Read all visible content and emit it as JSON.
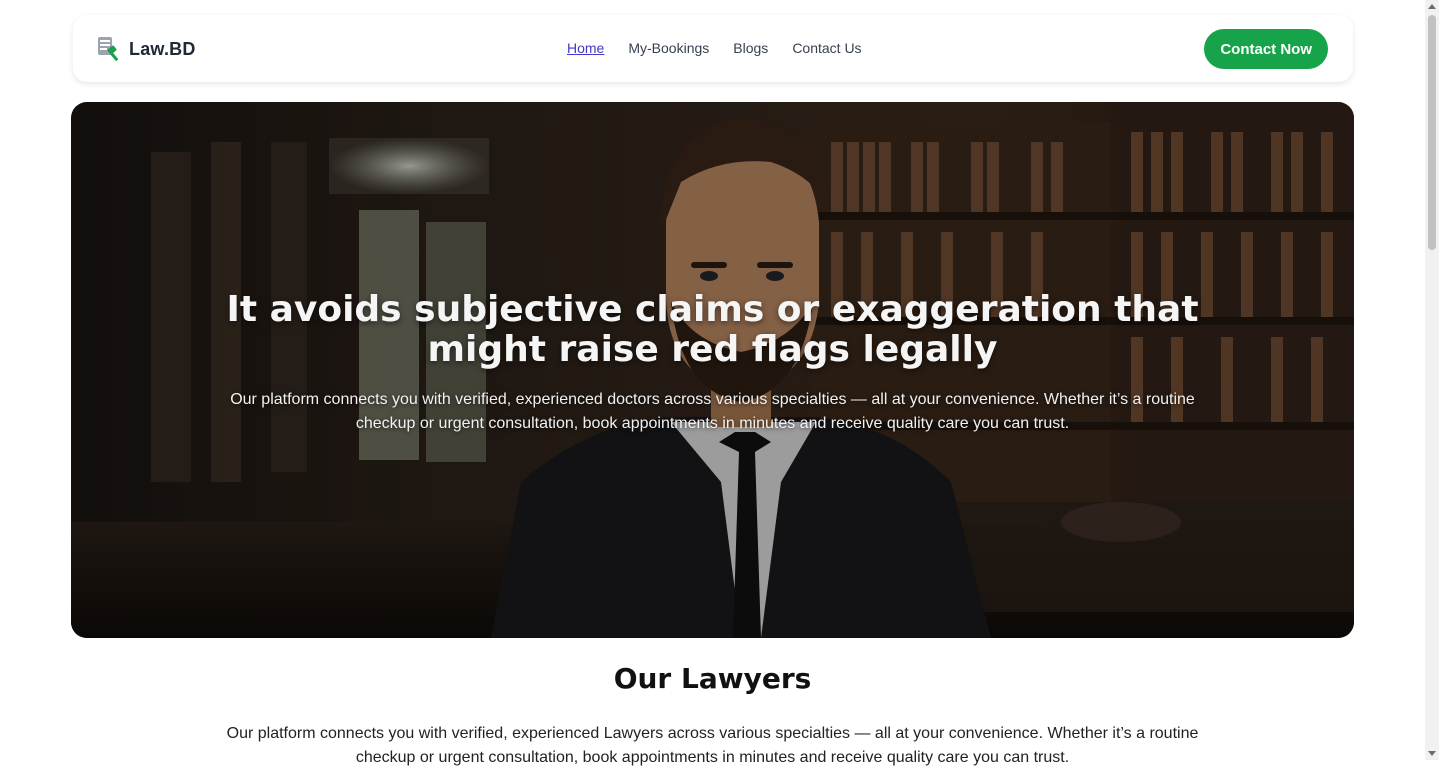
{
  "nav": {
    "brand": "Law.BD",
    "brand_icon": "gavel-document-icon",
    "links": [
      {
        "label": "Home",
        "active": true
      },
      {
        "label": "My-Bookings",
        "active": false
      },
      {
        "label": "Blogs",
        "active": false
      },
      {
        "label": "Contact Us",
        "active": false
      }
    ],
    "cta": "Contact Now"
  },
  "hero": {
    "title": "It avoids subjective claims or exaggeration that might raise red flags legally",
    "text": "Our platform connects you with verified, experienced doctors across various specialties — all at your convenience. Whether it’s a routine checkup or urgent consultation, book appointments in minutes and receive quality care you can trust."
  },
  "lawyers": {
    "title": "Our Lawyers",
    "text": "Our platform connects you with verified, experienced Lawyers across various specialties — all at your convenience. Whether it’s a routine checkup or urgent consultation, book appointments in minutes and receive quality care you can trust."
  },
  "colors": {
    "accent": "#16a34a",
    "active_link": "#4338ca"
  }
}
